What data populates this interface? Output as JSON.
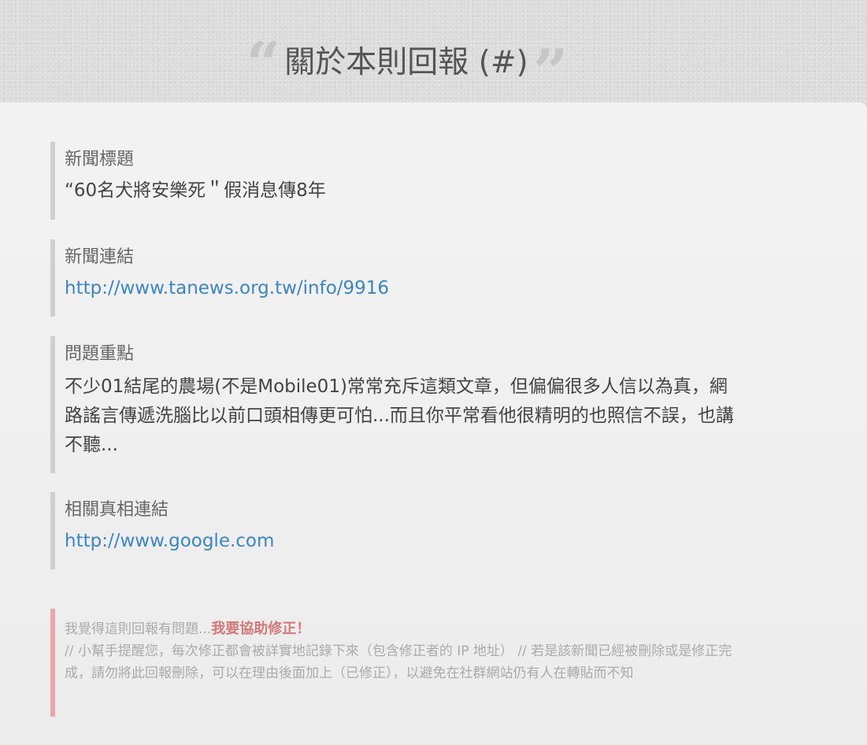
{
  "page": {
    "title": "關於本則回報 (#)"
  },
  "fields": {
    "news_title": {
      "label": "新聞標題",
      "value": "“60名犬將安樂死＂假消息傳8年"
    },
    "news_link": {
      "label": "新聞連結",
      "value": "http://www.tanews.org.tw/info/9916"
    },
    "problem": {
      "label": "問題重點",
      "value": "不少01結尾的農場(不是Mobile01)常常充斥這類文章，但偏偏很多人信以為真，網路謠言傳遞洗腦比以前口頭相傳更可怕...而且你平常看他很精明的也照信不誤，也講不聽..."
    },
    "truth_link": {
      "label": "相關真相連結",
      "value": "http://www.google.com"
    }
  },
  "note": {
    "prefix": "我覺得這則回報有問題...",
    "help_link": "我要協助修正！",
    "body": "// 小幫手提醒您，每次修正都會被詳實地記錄下來（包含修正者的 IP 地址） // 若是該新聞已經被刪除或是修正完成，請勿將此回報刪除，可以在理由後面加上（已修正），以避免在社群網站仍有人在轉貼而不知"
  },
  "colors": {
    "link": "#3a87c4",
    "help_link": "#d47878",
    "field_border": "#cfcfcf",
    "note_border": "#e6a8a8"
  }
}
